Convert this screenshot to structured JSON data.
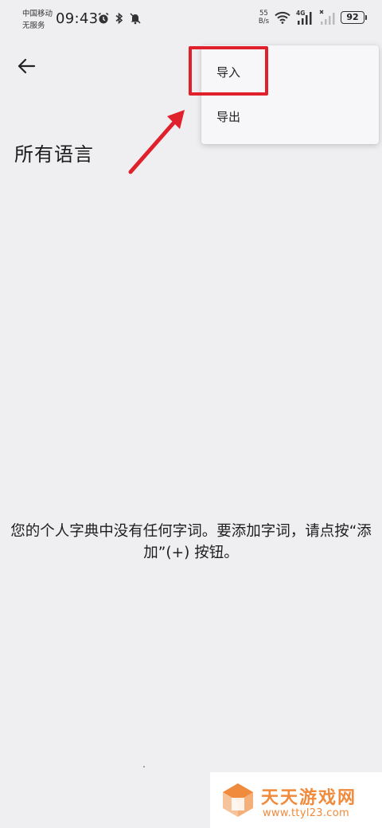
{
  "status_bar": {
    "carrier_line1": "中国移动",
    "carrier_line2": "无服务",
    "time": "09:43",
    "net_speed_value": "55",
    "net_speed_unit": "B/s",
    "network_type": "4G",
    "battery": "92"
  },
  "header": {
    "title": "所有语言"
  },
  "overflow_menu": {
    "items": [
      {
        "label": "导入"
      },
      {
        "label": "导出"
      }
    ]
  },
  "empty_state": {
    "message": "您的个人字典中没有任何字词。要添加字词，请点按“添加”(+) 按钮。"
  },
  "annotation": {
    "color": "#e0202a"
  },
  "watermark": {
    "title": "天天游戏网",
    "url": "www.ttyl23.com",
    "color": "#f08a3c"
  }
}
